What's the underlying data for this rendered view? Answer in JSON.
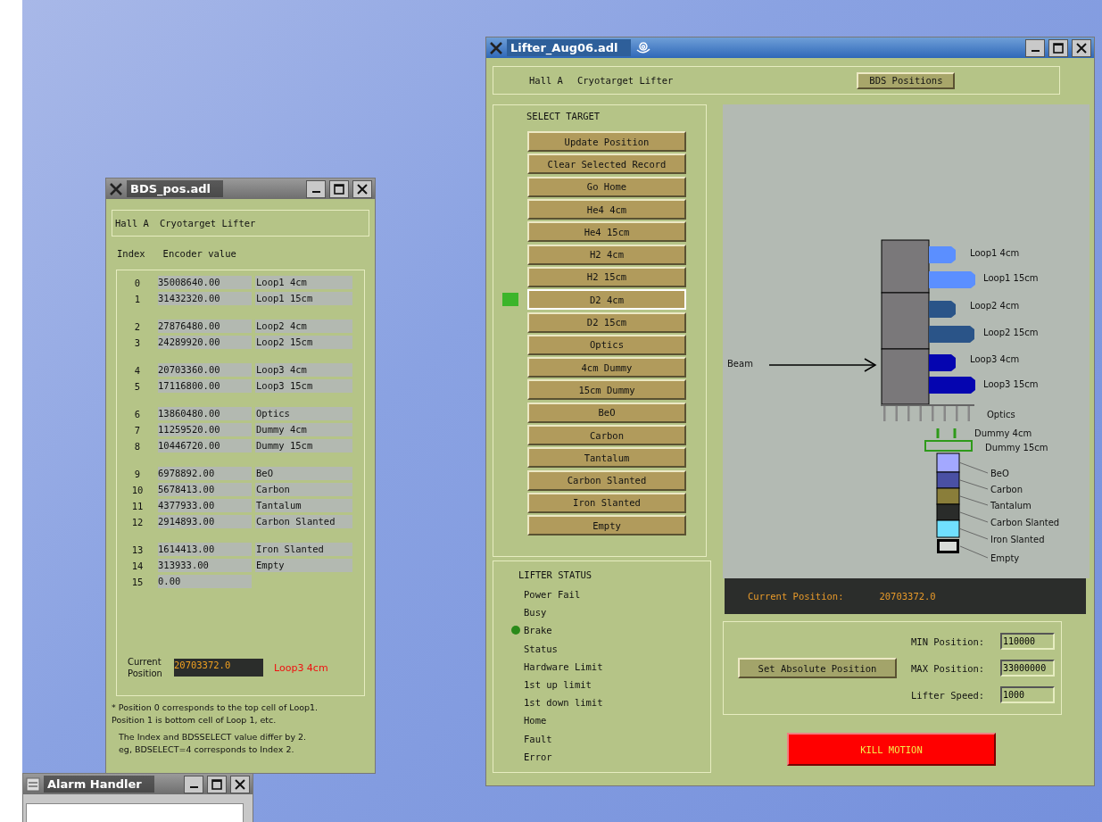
{
  "bds_window": {
    "title": "BDS_pos.adl",
    "header": [
      "Hall A",
      "Cryotarget Lifter"
    ],
    "columns": [
      "Index",
      "Encoder value"
    ],
    "groups": [
      [
        {
          "index": "0",
          "encoder": "35008640.00",
          "target": "Loop1 4cm"
        },
        {
          "index": "1",
          "encoder": "31432320.00",
          "target": "Loop1 15cm"
        }
      ],
      [
        {
          "index": "2",
          "encoder": "27876480.00",
          "target": "Loop2 4cm"
        },
        {
          "index": "3",
          "encoder": "24289920.00",
          "target": "Loop2 15cm"
        }
      ],
      [
        {
          "index": "4",
          "encoder": "20703360.00",
          "target": "Loop3 4cm"
        },
        {
          "index": "5",
          "encoder": "17116800.00",
          "target": "Loop3 15cm"
        }
      ],
      [
        {
          "index": "6",
          "encoder": "13860480.00",
          "target": "Optics"
        },
        {
          "index": "7",
          "encoder": "11259520.00",
          "target": "Dummy 4cm"
        },
        {
          "index": "8",
          "encoder": "10446720.00",
          "target": "Dummy 15cm"
        }
      ],
      [
        {
          "index": "9",
          "encoder": "6978892.00",
          "target": "BeO"
        },
        {
          "index": "10",
          "encoder": "5678413.00",
          "target": "Carbon"
        },
        {
          "index": "11",
          "encoder": "4377933.00",
          "target": "Tantalum"
        },
        {
          "index": "12",
          "encoder": "2914893.00",
          "target": "Carbon Slanted"
        }
      ],
      [
        {
          "index": "13",
          "encoder": "1614413.00",
          "target": "Iron Slanted"
        },
        {
          "index": "14",
          "encoder": "313933.00",
          "target": "Empty"
        },
        {
          "index": "15",
          "encoder": "0.00"
        }
      ]
    ],
    "current_position": {
      "label": "Current Position",
      "value": "20703372.0",
      "target": "Loop3 4cm"
    },
    "notes": [
      [
        "* Position 0 corresponds to the top cell of Loop1.",
        "Position 1 is bottom cell of Loop 1, etc."
      ],
      [
        "The Index and BDSSELECT value differ by 2.",
        "eg, BDSELECT=4 corresponds to Index 2."
      ]
    ]
  },
  "lifter_window": {
    "title": "Lifter_Aug06.adl",
    "header": [
      "Hall A",
      "Cryotarget Lifter"
    ],
    "header_button": "BDS Positions",
    "select_target": {
      "title": "SELECT TARGET",
      "buttons": [
        {
          "label": "Update Position",
          "selected": false
        },
        {
          "label": "Clear Selected Record",
          "selected": false
        },
        {
          "label": "Go Home",
          "selected": false
        },
        {
          "label": "He4 4cm",
          "selected": false
        },
        {
          "label": "He4 15cm",
          "selected": false
        },
        {
          "label": "H2 4cm",
          "selected": false
        },
        {
          "label": "H2 15cm",
          "selected": false
        },
        {
          "label": "D2 4cm",
          "selected": true
        },
        {
          "label": "D2 15cm",
          "selected": false
        },
        {
          "label": "Optics",
          "selected": false
        },
        {
          "label": "4cm Dummy",
          "selected": false
        },
        {
          "label": "15cm Dummy",
          "selected": false
        },
        {
          "label": "BeO",
          "selected": false
        },
        {
          "label": "Carbon",
          "selected": false
        },
        {
          "label": "Tantalum",
          "selected": false
        },
        {
          "label": "Carbon Slanted",
          "selected": false
        },
        {
          "label": "Iron Slanted",
          "selected": false
        },
        {
          "label": "Empty",
          "selected": false
        }
      ]
    },
    "lifter_status": {
      "title": "LIFTER STATUS",
      "items": [
        {
          "label": "Power Fail",
          "on": false
        },
        {
          "label": "Busy",
          "on": false
        },
        {
          "label": "Brake",
          "on": true
        },
        {
          "label": "Status",
          "on": false
        },
        {
          "label": "Hardware Limit",
          "on": false
        },
        {
          "label": "1st up limit",
          "on": false
        },
        {
          "label": "1st down limit",
          "on": false
        },
        {
          "label": "Home",
          "on": false
        },
        {
          "label": "Fault",
          "on": false
        },
        {
          "label": "Error",
          "on": false
        }
      ]
    },
    "diagram": {
      "beam_label": "Beam",
      "targets": [
        {
          "kind": "loop",
          "label": "Loop1 4cm",
          "color": "#5b8fff"
        },
        {
          "kind": "loop",
          "label": "Loop1 15cm",
          "color": "#5b8fff"
        },
        {
          "kind": "loop",
          "label": "Loop2 4cm",
          "color": "#2a5488"
        },
        {
          "kind": "loop",
          "label": "Loop2 15cm",
          "color": "#2a5488"
        },
        {
          "kind": "loop",
          "label": "Loop3 4cm",
          "color": "#0505b0"
        },
        {
          "kind": "loop",
          "label": "Loop3 15cm",
          "color": "#0505b0"
        },
        {
          "kind": "optics",
          "label": "Optics"
        },
        {
          "kind": "dummy-pair",
          "label": "Dummy 4cm"
        },
        {
          "kind": "dummy-frame",
          "label": "Dummy 15cm"
        },
        {
          "kind": "solid",
          "label": "BeO",
          "color": "#a3a8ff"
        },
        {
          "kind": "solid",
          "label": "Carbon",
          "color": "#4a50a4"
        },
        {
          "kind": "solid",
          "label": "Tantalum",
          "color": "#8a7e3a"
        },
        {
          "kind": "solid",
          "label": "Carbon Slanted",
          "color": "#2a2c2a"
        },
        {
          "kind": "solid",
          "label": "Iron Slanted",
          "color": "#70e0ff"
        },
        {
          "kind": "empty",
          "label": "Empty"
        }
      ]
    },
    "current_position": {
      "label": "Current Position:",
      "value": "20703372.0"
    },
    "set_button": "Set Absolute Position",
    "fields": [
      {
        "label": "MIN Position:",
        "value": "110000"
      },
      {
        "label": "MAX Position:",
        "value": "33000000"
      },
      {
        "label": "Lifter Speed:",
        "value": "1000"
      }
    ],
    "kill_button": "KILL MOTION"
  },
  "alarm_window": {
    "title": "Alarm Handler"
  }
}
